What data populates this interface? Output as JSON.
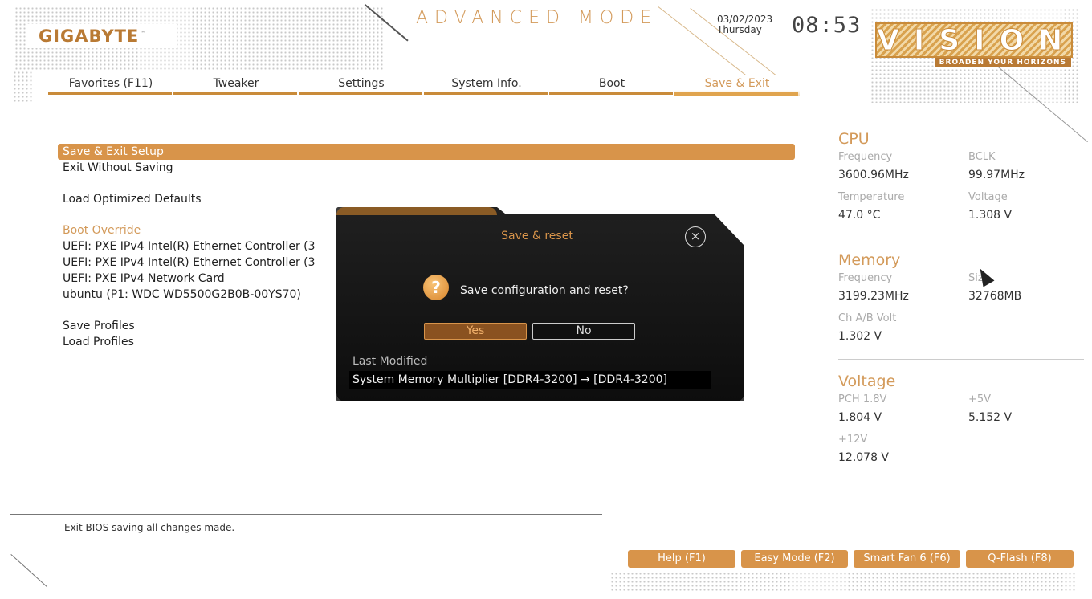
{
  "header": {
    "brand": "GIGABYTE",
    "brand_tm": "™",
    "mode": "ADVANCED MODE",
    "date": "03/02/2023",
    "weekday": "Thursday",
    "time": "08:53",
    "vision_word": "VISION",
    "vision_tagline": "BROADEN YOUR HORIZONS"
  },
  "tabs": [
    {
      "label": "Favorites (F11)"
    },
    {
      "label": "Tweaker"
    },
    {
      "label": "Settings"
    },
    {
      "label": "System Info."
    },
    {
      "label": "Boot"
    },
    {
      "label": "Save & Exit",
      "active": true
    }
  ],
  "menu": {
    "save_exit_setup": "Save & Exit Setup",
    "exit_without_saving": "Exit Without Saving",
    "load_optimized_defaults": "Load Optimized Defaults",
    "boot_override": "Boot Override",
    "boot_items": [
      "UEFI: PXE IPv4 Intel(R) Ethernet Controller (3",
      "UEFI: PXE IPv4 Intel(R) Ethernet Controller (3",
      "UEFI: PXE IPv4 Network Card",
      "ubuntu (P1: WDC  WD5500G2B0B-00YS70)"
    ],
    "save_profiles": "Save Profiles",
    "load_profiles": "Load Profiles"
  },
  "sidebar": {
    "cpu": {
      "title": "CPU",
      "frequency_label": "Frequency",
      "frequency": "3600.96MHz",
      "bclk_label": "BCLK",
      "bclk": "99.97MHz",
      "temperature_label": "Temperature",
      "temperature": "47.0 °C",
      "voltage_label": "Voltage",
      "voltage": "1.308 V"
    },
    "memory": {
      "title": "Memory",
      "frequency_label": "Frequency",
      "frequency": "3199.23MHz",
      "size_label": "Size",
      "size": "32768MB",
      "chab_label": "Ch A/B Volt",
      "chab": "1.302 V"
    },
    "voltage": {
      "title": "Voltage",
      "pch_label": "PCH 1.8V",
      "pch": "1.804 V",
      "v5_label": "+5V",
      "v5": "5.152 V",
      "v12_label": "+12V",
      "v12": "12.078 V"
    }
  },
  "help_text": "Exit BIOS saving all changes made.",
  "fkeys": [
    {
      "label": "Help (F1)"
    },
    {
      "label": "Easy Mode (F2)"
    },
    {
      "label": "Smart Fan 6 (F6)"
    },
    {
      "label": "Q-Flash (F8)"
    }
  ],
  "dialog": {
    "title": "Save & reset",
    "close_glyph": "×",
    "question_glyph": "?",
    "question": "Save configuration and reset?",
    "yes": "Yes",
    "no": "No",
    "last_modified_label": "Last Modified",
    "last_modified_item": "System Memory Multiplier  [DDR4-3200] → [DDR4-3200]"
  },
  "colors": {
    "accent": "#d8944a",
    "accent_text": "#d39a5a",
    "dialog_bg": "#141414"
  }
}
